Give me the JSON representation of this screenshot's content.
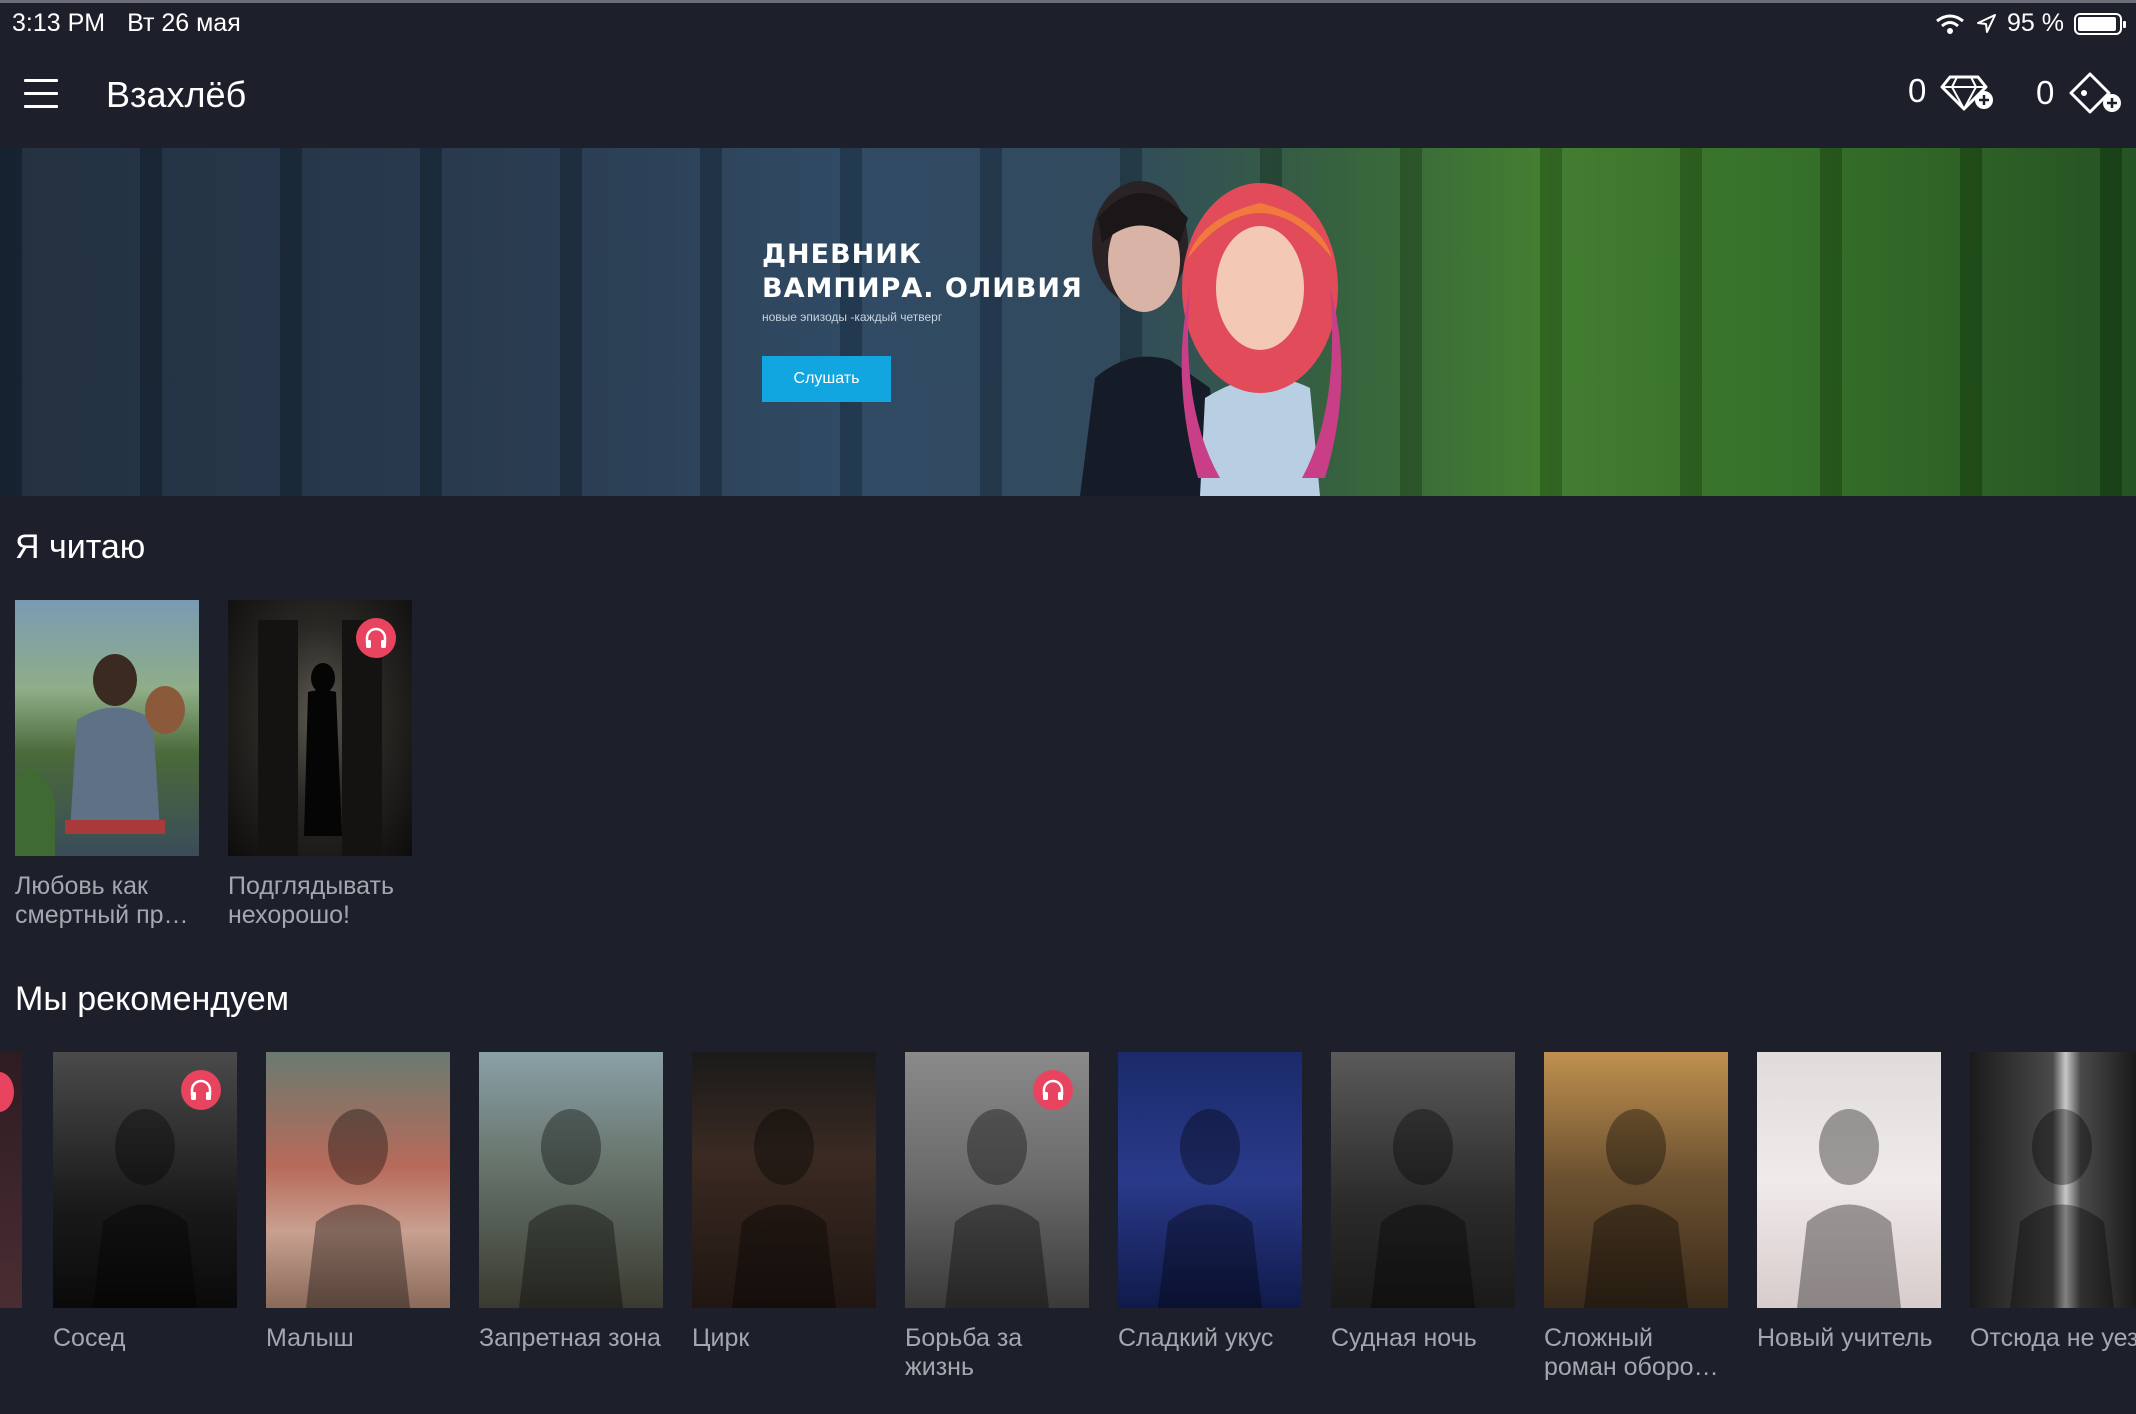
{
  "status_bar": {
    "time": "3:13 PM",
    "date": "Вт 26 мая",
    "battery": "95 %",
    "icons": [
      "wifi-icon",
      "location-arrow-icon",
      "battery-icon"
    ]
  },
  "app_bar": {
    "title": "Взахлёб",
    "gems_count": "0",
    "keys_count": "0"
  },
  "banner": {
    "title": "ДНЕВНИК ВАМПИРА. ОЛИВИЯ",
    "subtitle": "новые эпизоды -каждый четверг",
    "button_label": "Слушать"
  },
  "reading": {
    "title": "Я читаю",
    "books": [
      {
        "title": "Любовь как смертный пр…",
        "audio": false
      },
      {
        "title": "Подглядывать нехорошо!",
        "audio": true
      }
    ]
  },
  "recommended": {
    "title": "Мы рекомендуем",
    "books": [
      {
        "title": "Сосед",
        "audio": true
      },
      {
        "title": "Малыш",
        "audio": false
      },
      {
        "title": "Запретная зона",
        "audio": false
      },
      {
        "title": "Цирк",
        "audio": false
      },
      {
        "title": "Борьба за жизнь",
        "audio": true
      },
      {
        "title": "Сладкий укус",
        "audio": false
      },
      {
        "title": "Судная ночь",
        "audio": false
      },
      {
        "title": "Сложный роман оборо…",
        "audio": false
      },
      {
        "title": "Новый учитель",
        "audio": false
      },
      {
        "title": "Отсюда не уезжают…",
        "audio": false
      }
    ]
  },
  "colors": {
    "background": "#1d1f2a",
    "accent_button": "#11a6e0",
    "audio_badge": "#e8445f",
    "book_title": "#a4a7b0"
  }
}
